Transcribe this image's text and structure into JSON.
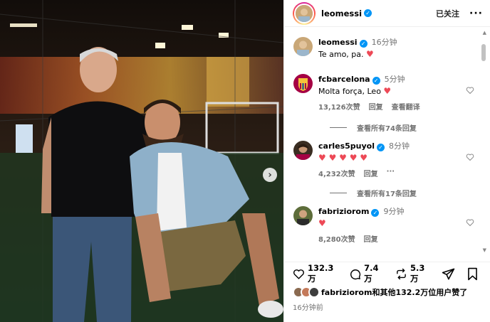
{
  "post": {
    "username": "leomessi",
    "follow_status": "已关注",
    "more_icon": "more-horizontal-icon"
  },
  "caption": {
    "username": "leomessi",
    "time": "16分钟",
    "text": "Te amo, pa. "
  },
  "comments": [
    {
      "username": "fcbarcelona",
      "time": "5分钟",
      "text": "Molta força, Leo ",
      "likes": "13,126次赞",
      "reply": "回复",
      "translate": "查看翻译",
      "view_replies": "查看所有74条回复"
    },
    {
      "username": "carles5puyol",
      "time": "8分钟",
      "text": "",
      "hearts": "♥ ♥ ♥ ♥ ♥",
      "likes": "4,232次赞",
      "reply": "回复",
      "view_replies": "查看所有17条回复"
    },
    {
      "username": "fabriziorom",
      "time": "9分钟",
      "text": "",
      "hearts": "♥",
      "likes": "8,280次赞",
      "reply": "回复"
    }
  ],
  "actions": {
    "like_count": "132.3 万",
    "comment_count": "7.4 万",
    "share_count": "5.3 万"
  },
  "likes_summary": {
    "lead_user": "fabriziorom",
    "rest": "和其他132.2万位用户赞了"
  },
  "posted_time": "16分钟前",
  "colors": {
    "verified": "#0095f6",
    "heart": "#ed4956",
    "muted": "#737373"
  }
}
